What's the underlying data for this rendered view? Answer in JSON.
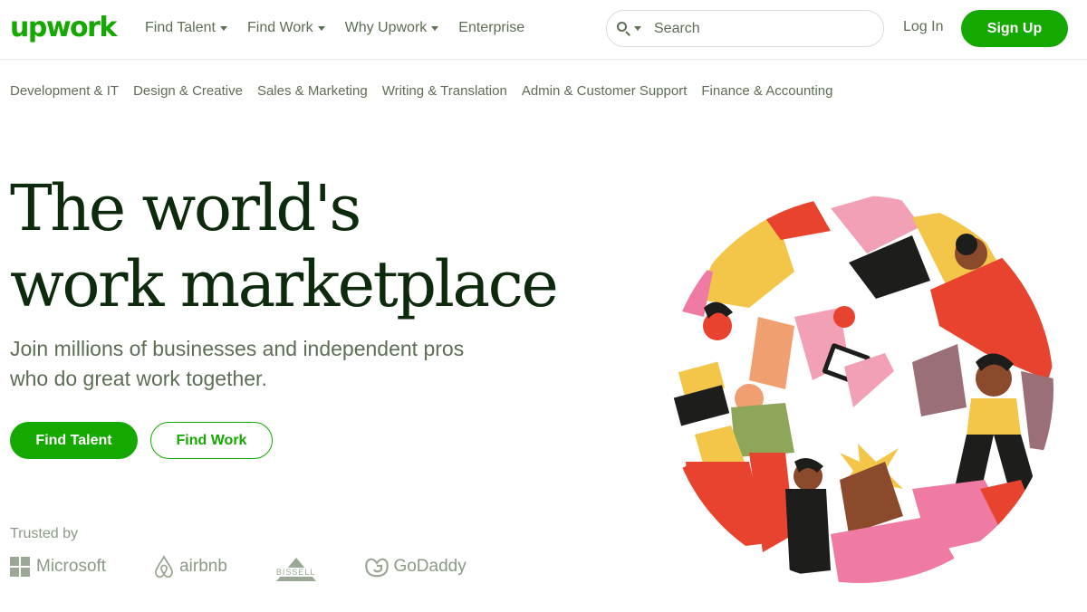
{
  "header": {
    "logo": "upwork",
    "nav": [
      {
        "label": "Find Talent",
        "dropdown": true
      },
      {
        "label": "Find Work",
        "dropdown": true
      },
      {
        "label": "Why Upwork",
        "dropdown": true
      },
      {
        "label": "Enterprise",
        "dropdown": false
      }
    ],
    "search_placeholder": "Search",
    "login_label": "Log In",
    "signup_label": "Sign Up"
  },
  "categories": [
    "Development & IT",
    "Design & Creative",
    "Sales & Marketing",
    "Writing & Translation",
    "Admin & Customer Support",
    "Finance & Accounting"
  ],
  "hero": {
    "title_line1": "The world's",
    "title_line2": "work marketplace",
    "subtitle_line1": "Join millions of businesses and independent pros",
    "subtitle_line2": "who do great work together.",
    "find_talent_label": "Find Talent",
    "find_work_label": "Find Work"
  },
  "trusted": {
    "label": "Trusted by",
    "brands": [
      "Microsoft",
      "airbnb",
      "BISSELL",
      "GoDaddy"
    ]
  },
  "colors": {
    "brand_green": "#14a800",
    "text_dark": "#001e00",
    "text_muted": "#5e6d55"
  }
}
